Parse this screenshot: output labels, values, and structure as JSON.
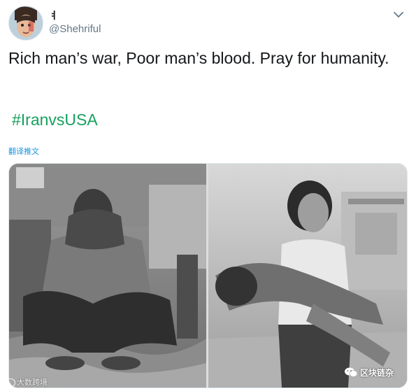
{
  "tweet": {
    "display_name": "ㅕ",
    "handle": "@Shehriful",
    "text": "Rich man’s war, Poor man’s blood. Pray for humanity.",
    "hashtag": "#IranvsUSA",
    "translate_label": "翻译推文"
  },
  "media": {
    "photo_count": 2,
    "icons": [
      "avatar",
      "chevron-down-icon",
      "wechat-icon"
    ]
  },
  "watermarks": {
    "left": "大数跨境",
    "right": "区块链杂"
  },
  "colors": {
    "hashtag": "#17a05f",
    "translate": "#1b95e0",
    "handle": "#657786",
    "text": "#14171a"
  }
}
